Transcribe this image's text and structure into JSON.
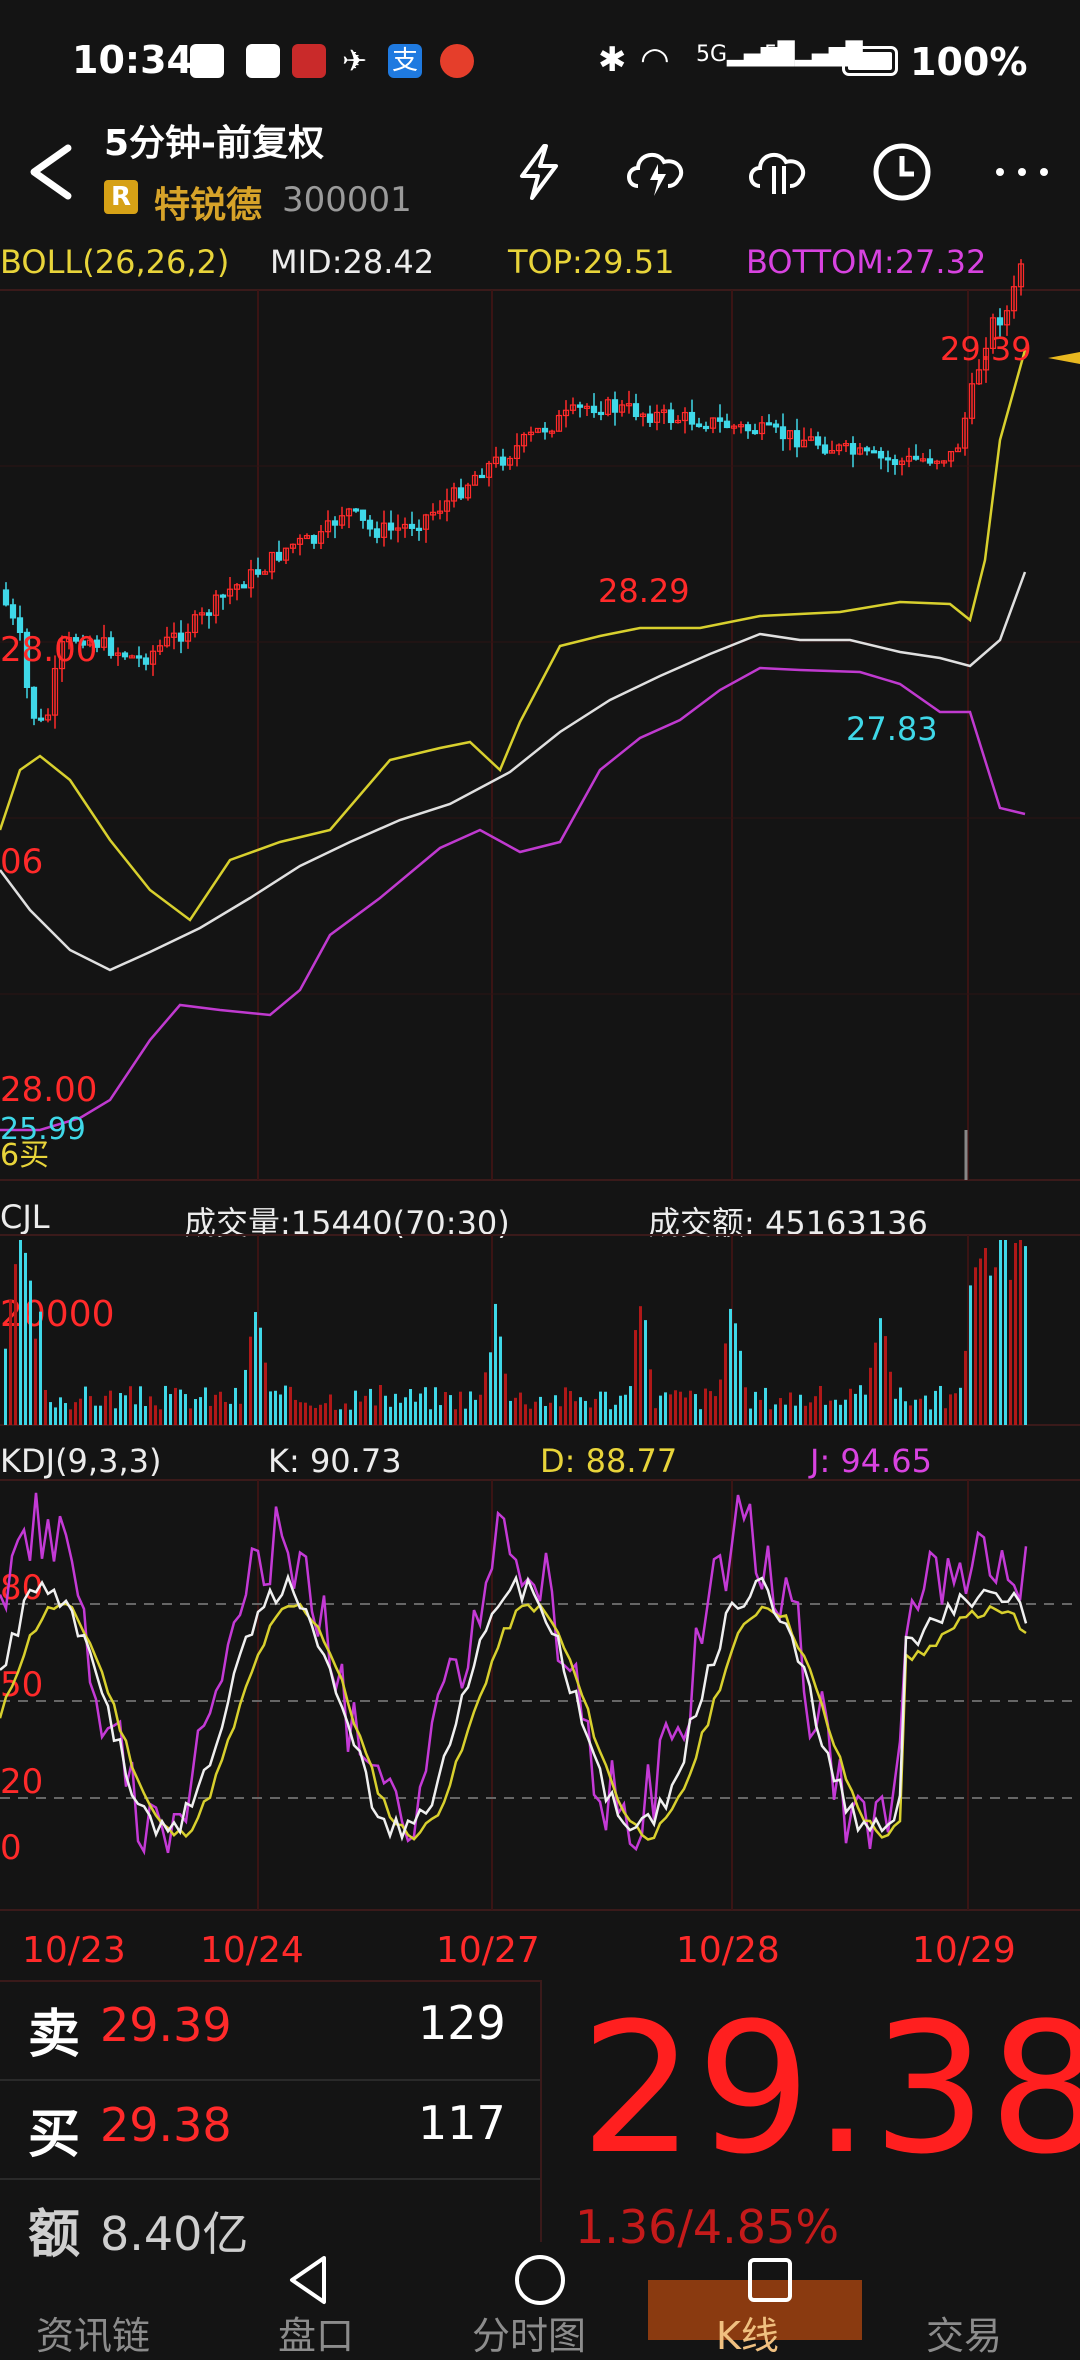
{
  "status_bar": {
    "time": "10:34",
    "battery_pct": "100%",
    "net1": "5G",
    "net2": "5G"
  },
  "header": {
    "title": "5分钟-前复权",
    "badge": "R",
    "stock_name": "特锐德",
    "stock_code": "300001",
    "icons": [
      "back-icon",
      "lightning-icon",
      "cloud-upload-icon",
      "cloud-download-icon",
      "clock-icon",
      "more-icon"
    ]
  },
  "boll": {
    "label": "BOLL(26,26,2)",
    "mid": "MID:28.42",
    "top": "TOP:29.51",
    "bottom": "BOTTOM:27.32",
    "annotations": {
      "high_right": "29.39",
      "high_mid": "28.29",
      "low_mid": "27.83",
      "low_left": "25.99",
      "price_28": "28.00",
      "price_28_low": "28.00",
      "left_06": "06",
      "left_buy": "6买"
    }
  },
  "cjl": {
    "label": "CJL",
    "volume": "成交量:15440(70:30)",
    "amount": "成交额: 45163136",
    "axis": "20000"
  },
  "kdj": {
    "label": "KDJ(9,3,3)",
    "k": "K: 90.73",
    "d": "D: 88.77",
    "j": "J: 94.65",
    "levels": [
      "80",
      "50",
      "20",
      "0"
    ]
  },
  "dates": [
    "10/23",
    "10/24",
    "10/27",
    "10/28",
    "10/29"
  ],
  "quote": {
    "sell_label": "卖",
    "sell_price": "29.39",
    "sell_vol": "129",
    "buy_label": "买",
    "buy_price": "29.38",
    "buy_vol": "117",
    "amount_label": "额",
    "amount_value": "8.40亿",
    "last_price": "29.38",
    "change": "1.36/4.85%"
  },
  "tabs": [
    "资讯链",
    "盘口",
    "分时图",
    "K线",
    "交易"
  ],
  "colors": {
    "up": "#ff2a2a",
    "down": "#3fd8e8",
    "mid_line": "#e0e0e0",
    "top_line": "#d8d02e",
    "bottom_line": "#c03ad0"
  }
}
